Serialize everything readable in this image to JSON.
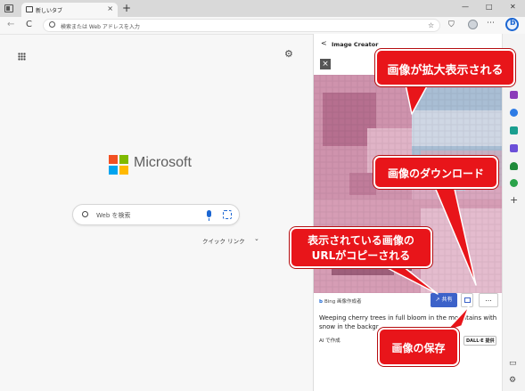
{
  "browser": {
    "tab_title": "新しいタブ",
    "tab_close": "×",
    "new_tab": "+",
    "window_minimize": "—",
    "window_maximize": "□",
    "window_close": "✕",
    "back": "←",
    "reload": "C",
    "address_placeholder": "検索または Web アドレスを入力"
  },
  "new_tab_page": {
    "brand": "Microsoft",
    "search_placeholder": "Web を検索",
    "quick_links": "クイック リンク"
  },
  "panel": {
    "title": "Image Creator",
    "back": "<",
    "close": "×",
    "attribution": "Bing 画像作成者",
    "share_label": "共有",
    "more_label": "...",
    "prompt": "Weeping cherry trees in full bloom in the mountains with snow in the backgr",
    "ai_made": "AI で作成",
    "dalle_badge": "DALL·E 提供"
  },
  "callouts": {
    "enlarge": "画像が拡大表示される",
    "download": "画像のダウンロード",
    "url_copy_line1": "表示されている画像の",
    "url_copy_line2": "URLがコピーされる",
    "save": "画像の保存"
  },
  "colors": {
    "callout": "#e8151a",
    "accent_blue": "#1b66d2",
    "share_button": "#3c62c9"
  }
}
